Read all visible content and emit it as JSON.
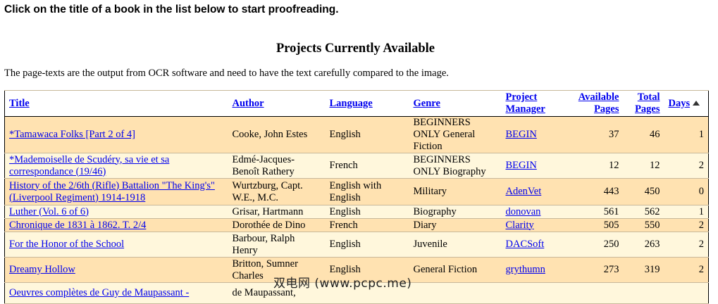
{
  "instruction": "Click on the title of a book in the list below to start proofreading.",
  "heading": "Projects Currently Available",
  "intro": "The page-texts are the output from OCR software and need to have the text carefully compared to the image.",
  "columns": {
    "title": "Title",
    "author": "Author",
    "language": "Language",
    "genre": "Genre",
    "manager": "Project Manager",
    "available": "Available Pages",
    "total": "Total Pages",
    "days": "Days"
  },
  "rows": [
    {
      "title": "*Tamawaca Folks [Part 2 of 4]",
      "author": "Cooke, John Estes",
      "language": "English",
      "genre": "BEGINNERS ONLY General Fiction",
      "manager": "BEGIN",
      "available": "37",
      "total": "46",
      "days": "1"
    },
    {
      "title": "*Mademoiselle de Scudéry, sa vie et sa correspondance (19/46)",
      "author": "Edmé-Jacques-Benoît Rathery",
      "language": "French",
      "genre": "BEGINNERS ONLY Biography",
      "manager": "BEGIN",
      "available": "12",
      "total": "12",
      "days": "2"
    },
    {
      "title": "History of the 2/6th (Rifle) Battalion \"The King's\" (Liverpool Regiment) 1914-1918",
      "author": "Wurtzburg, Capt. W.E., M.C.",
      "language": "English with English",
      "genre": "Military",
      "manager": "AdenVet",
      "available": "443",
      "total": "450",
      "days": "0"
    },
    {
      "title": "Luther (Vol. 6 of 6)",
      "author": "Grisar, Hartmann",
      "language": "English",
      "genre": "Biography",
      "manager": "donovan",
      "available": "561",
      "total": "562",
      "days": "1"
    },
    {
      "title": "Chronique de 1831 à 1862. T. 2/4",
      "author": "Dorothée de Dino",
      "language": "French",
      "genre": "Diary",
      "manager": "Clarity",
      "available": "505",
      "total": "550",
      "days": "2"
    },
    {
      "title": "For the Honor of the School",
      "author": "Barbour, Ralph Henry",
      "language": "English",
      "genre": "Juvenile",
      "manager": "DACSoft",
      "available": "250",
      "total": "263",
      "days": "2"
    },
    {
      "title": "Dreamy Hollow",
      "author": "Britton, Sumner Charles",
      "language": "English",
      "genre": "General Fiction",
      "manager": "grythumn",
      "available": "273",
      "total": "319",
      "days": "2"
    },
    {
      "title": "Oeuvres complètes de Guy de Maupassant -",
      "author": "de Maupassant,",
      "language": "",
      "genre": "",
      "manager": "",
      "available": "",
      "total": "",
      "days": ""
    }
  ],
  "watermark": "双电网 (www.pcpc.me)"
}
